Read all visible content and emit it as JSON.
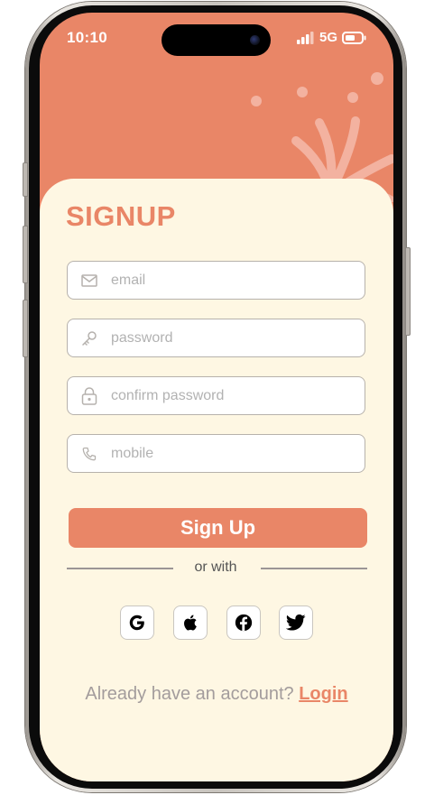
{
  "status_bar": {
    "time": "10:10",
    "network": "5G"
  },
  "page": {
    "title": "SIGNUP"
  },
  "form": {
    "email_placeholder": "email",
    "password_placeholder": "password",
    "confirm_placeholder": "confirm password",
    "mobile_placeholder": "mobile",
    "submit_label": "Sign Up"
  },
  "social": {
    "divider_text": "or with",
    "providers": [
      "google-icon",
      "apple-icon",
      "facebook-icon",
      "twitter-icon"
    ]
  },
  "footer": {
    "prompt": "Already have an account?",
    "login_label": "Login"
  },
  "colors": {
    "accent": "#e98667",
    "card_background": "#fef7e3",
    "muted_text": "#a39c9c"
  }
}
